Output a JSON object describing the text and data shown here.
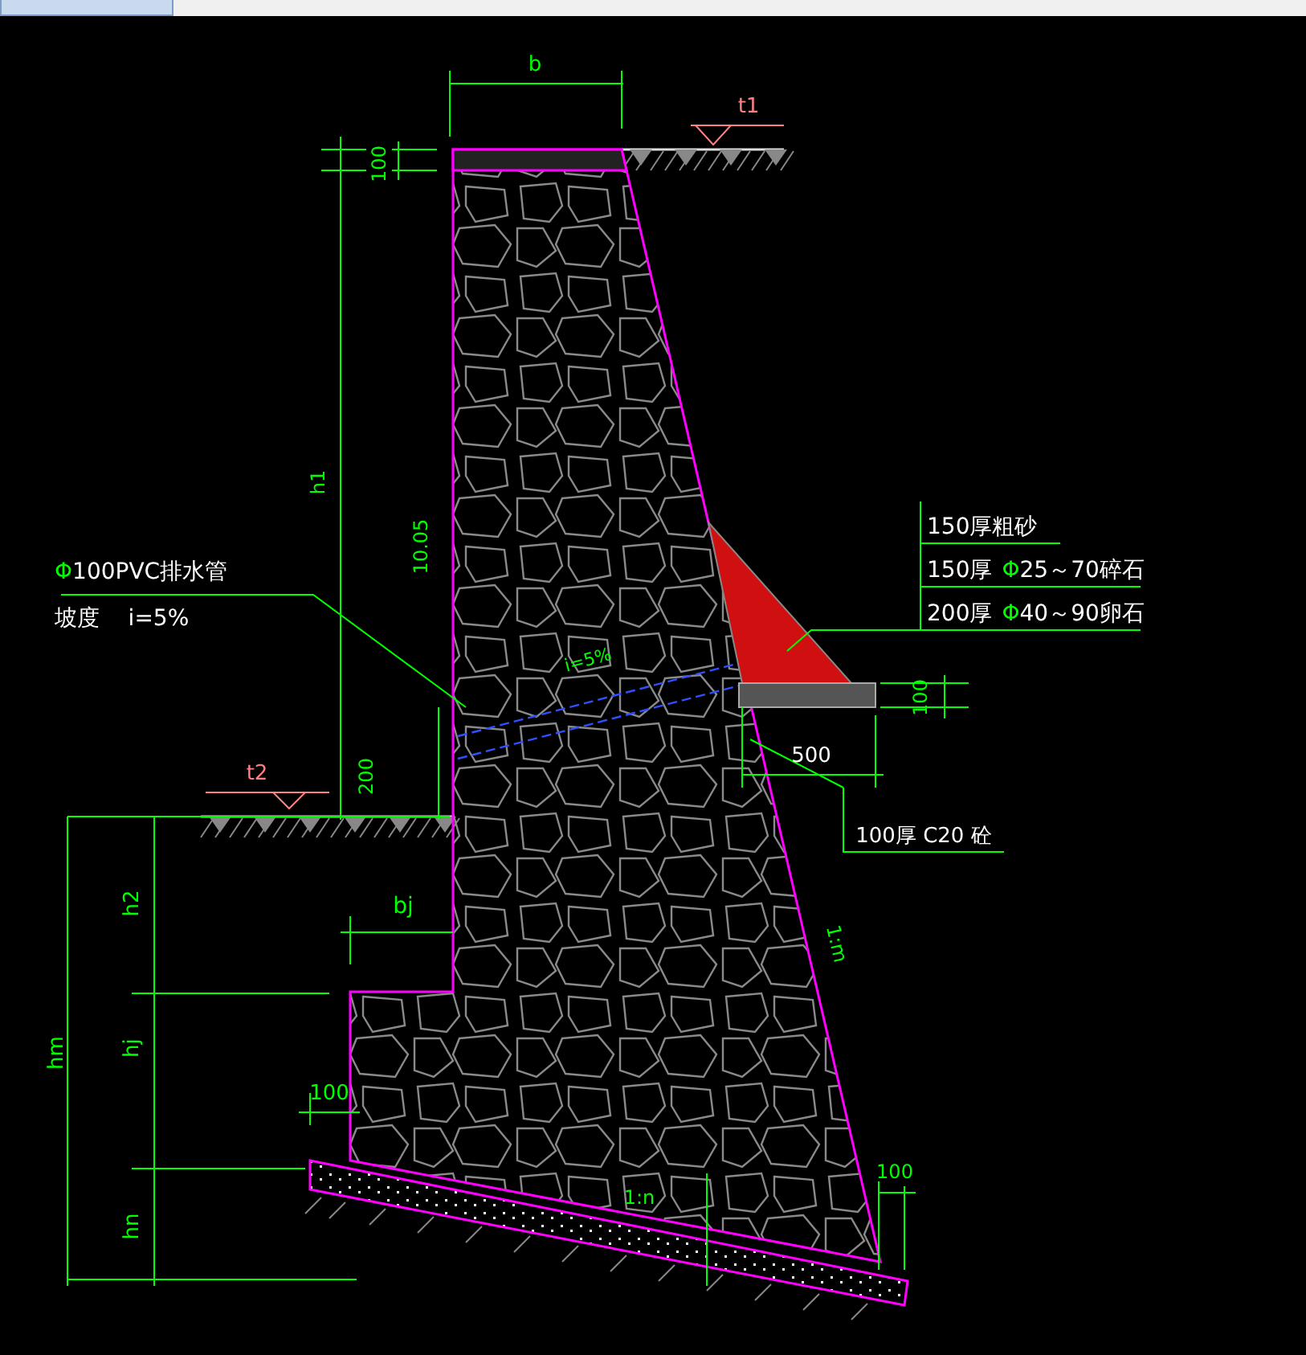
{
  "labels": [
    {
      "text": "b"
    },
    {
      "text": "t1"
    },
    {
      "text": "100"
    },
    {
      "text": "h1"
    },
    {
      "text": "10.05"
    },
    {
      "text": "i=5%"
    },
    {
      "text": "100"
    },
    {
      "text": "500"
    },
    {
      "text": "100厚 C20 砼"
    },
    {
      "text": "t2"
    },
    {
      "text": "200"
    },
    {
      "text": "1:m"
    },
    {
      "text": "bj"
    },
    {
      "text": "h2"
    },
    {
      "text": "hm"
    },
    {
      "text": "hj"
    },
    {
      "text": "100"
    },
    {
      "text": "hn"
    },
    {
      "text": "1:n"
    },
    {
      "text": "100"
    }
  ],
  "pipe_note": {
    "symbol": "Φ",
    "text": "100PVC排水管",
    "slope": "坡度    i=5%"
  },
  "filter_notes": [
    {
      "text": "150厚粗砂"
    },
    {
      "text": "150厚",
      "symbol": "Φ",
      "spec": "25～70碎石"
    },
    {
      "text": "200厚",
      "symbol": "Φ",
      "spec": "40～90卵石"
    }
  ]
}
